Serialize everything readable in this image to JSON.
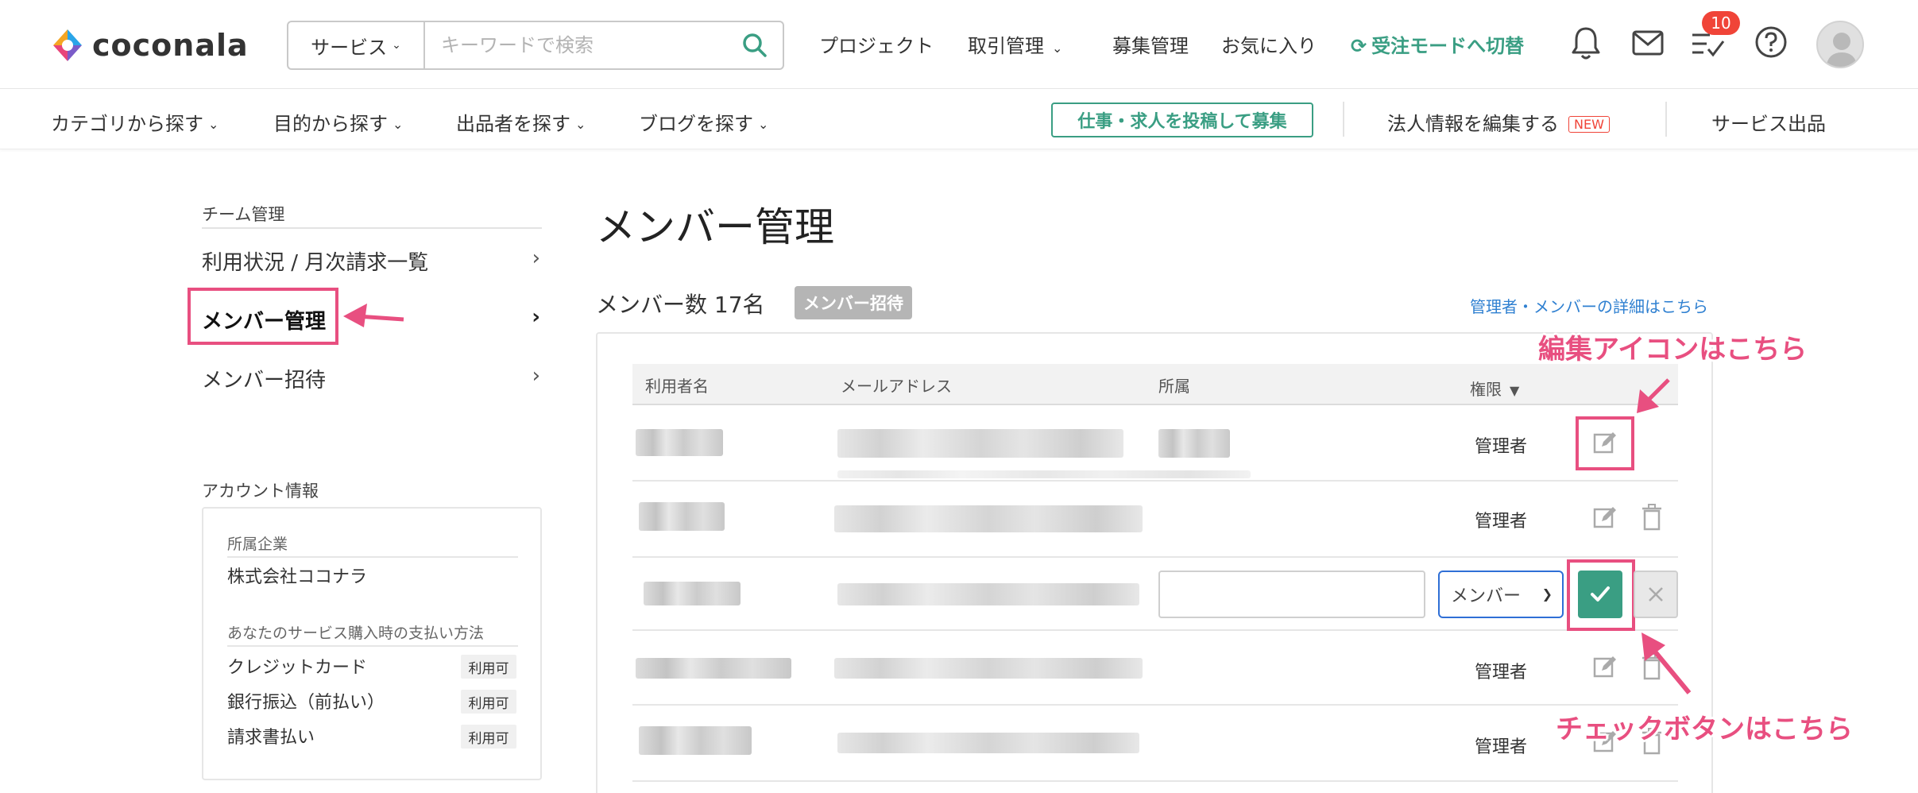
{
  "header": {
    "logo_text": "coconala",
    "search": {
      "category_label": "サービス",
      "placeholder": "キーワードで検索"
    },
    "nav": {
      "project": "プロジェクト",
      "transactions": "取引管理",
      "recruit": "募集管理",
      "favorites": "お気に入り",
      "mode_switch": "受注モードへ切替"
    },
    "todo_badge": "10",
    "accent_color": "#3a9e83"
  },
  "subnav": {
    "category": "カテゴリから探す",
    "purpose": "目的から探す",
    "seller": "出品者を探す",
    "blog": "ブログを探す",
    "post_job": "仕事・求人を投稿して募集",
    "edit_corp": "法人情報を編集する",
    "new_badge": "NEW",
    "list_service": "サービス出品"
  },
  "sidebar": {
    "team_heading": "チーム管理",
    "items": [
      {
        "label": "利用状況 / 月次請求一覧"
      },
      {
        "label": "メンバー管理"
      },
      {
        "label": "メンバー招待"
      }
    ],
    "account_heading": "アカウント情報",
    "account": {
      "company_label": "所属企業",
      "company_name": "株式会社ココナラ",
      "payment_label": "あなたのサービス購入時の支払い方法",
      "payments": [
        {
          "name": "クレジットカード",
          "status": "利用可"
        },
        {
          "name": "銀行振込（前払い）",
          "status": "利用可"
        },
        {
          "name": "請求書払い",
          "status": "利用可"
        }
      ]
    }
  },
  "main": {
    "title": "メンバー管理",
    "member_count": "メンバー数 17名",
    "invite_badge": "メンバー招待",
    "detail_link": "管理者・メンバーの詳細はこちら",
    "table": {
      "headers": {
        "name": "利用者名",
        "email": "メールアドレス",
        "affiliation": "所属",
        "role": "権限"
      },
      "rows": [
        {
          "role": "管理者"
        },
        {
          "role": "管理者"
        },
        {
          "role_select": "メンバー"
        },
        {
          "role": "管理者"
        },
        {
          "role": "管理者"
        }
      ]
    }
  },
  "annotations": {
    "edit_icon": "編集アイコンはこちら",
    "check_button": "チェックボタンはこちら",
    "color": "#e84f80"
  }
}
